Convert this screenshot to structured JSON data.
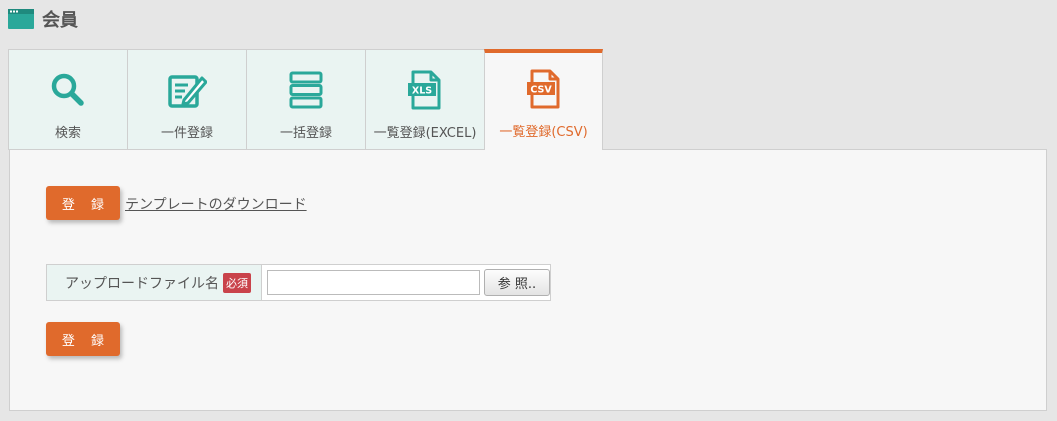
{
  "header": {
    "title": "会員",
    "icon": "window-icon",
    "accent_color": "#2aa89a"
  },
  "tabs": [
    {
      "label": "検索",
      "icon": "search-icon",
      "active": false
    },
    {
      "label": "一件登録",
      "icon": "edit-icon",
      "active": false
    },
    {
      "label": "一括登録",
      "icon": "list-icon",
      "active": false
    },
    {
      "label": "一覧登録(EXCEL)",
      "icon": "xls-file-icon",
      "icon_text": "XLS",
      "active": false
    },
    {
      "label": "一覧登録(CSV)",
      "icon": "csv-file-icon",
      "icon_text": "CSV",
      "active": true
    }
  ],
  "colors": {
    "teal": "#2aa89a",
    "orange": "#e06a2c",
    "required_red": "#c9434b"
  },
  "panel": {
    "register_label_top": "登 録",
    "template_link": "テンプレートのダウンロード",
    "upload_label": "アップロードファイル名",
    "required_badge": "必須",
    "file_name_value": "",
    "browse_label": "参 照..",
    "register_label_bottom": "登 録"
  }
}
